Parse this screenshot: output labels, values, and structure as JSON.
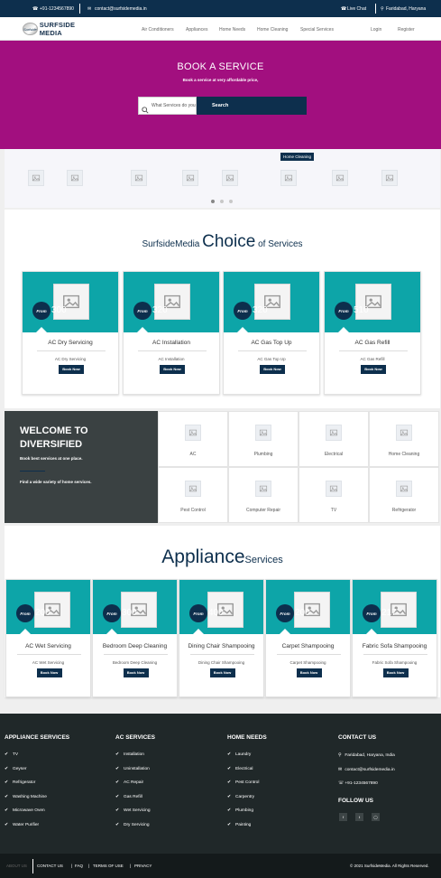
{
  "topbar": {
    "phone": "+91-1234567890",
    "email": "contact@surfsidemedia.in",
    "live_chat": "Live Chat",
    "location": "Faridabad, Haryana"
  },
  "navbar": {
    "logo_mark": "Surfside",
    "brand": "SURFSIDE MEDIA",
    "links": [
      "Air Conditioners",
      "Appliances",
      "Home Needs",
      "Home Cleaning",
      "Special Services"
    ],
    "login": "Login",
    "register": "Register"
  },
  "hero": {
    "title": "BOOK A SERVICE",
    "subtitle": "Book a service at very affordable price,",
    "search_placeholder": "What Services do you want",
    "search_button": "Search"
  },
  "slider": {
    "tag": "Home Cleaning",
    "icon_count_label": "8"
  },
  "choice": {
    "title_prefix": "SurfsideMedia",
    "title_highlight": "Choice",
    "title_suffix": "of Services",
    "from_label": "From",
    "book_label": "Book Now",
    "cards": [
      {
        "price": "300",
        "name": "AC Dry Servicing",
        "sub": "AC Dry Servicing"
      },
      {
        "price": "320",
        "name": "AC Installation",
        "sub": "AC Installation"
      },
      {
        "price": "320",
        "name": "AC Gas Top Up",
        "sub": "AC Gas Top Up"
      },
      {
        "price": "510",
        "name": "AC Gas Refill",
        "sub": "AC Gas Refill"
      }
    ]
  },
  "welcome": {
    "title_line1": "WELCOME TO",
    "title_line2": "DIVERSIFIED",
    "text1": "Book best services at one place.",
    "text2": "Find a wide variety of home services."
  },
  "categories": [
    "AC",
    "Plumbing",
    "Electrical",
    "Home Cleaning",
    "Pest Control",
    "Computer Repair",
    "TV",
    "Refrigerator"
  ],
  "appliance": {
    "title_highlight": "Appliance",
    "title_suffix": "Services",
    "from_label": "From",
    "book_label": "Book Now",
    "cards": [
      {
        "price": "200",
        "name": "AC Wet Servicing",
        "sub": "AC Wet Servicing"
      },
      {
        "price": "300",
        "name": "Bedroom Deep Cleaning",
        "sub": "Bedroom Deep Cleaning"
      },
      {
        "price": "400",
        "name": "Dining Chair Shampooing",
        "sub": "Dining Chair Shampooing"
      },
      {
        "price": "200",
        "name": "Carpet Shampooing",
        "sub": "Carpet Shampooing"
      },
      {
        "price": "217",
        "name": "Fabric Sofa Shampooing",
        "sub": "Fabric Sofa Shampooing"
      }
    ]
  },
  "footer": {
    "col1": {
      "title": "APPLIANCE SERVICES",
      "items": [
        "TV",
        "Geyser",
        "Refrigerator",
        "Washing Machine",
        "Microwave Oven",
        "Water Purifier"
      ]
    },
    "col2": {
      "title": "AC SERVICES",
      "items": [
        "Installation",
        "Uninstallation",
        "AC Repair",
        "Gas Refill",
        "Wet Servicing",
        "Dry Servicing"
      ]
    },
    "col3": {
      "title": "HOME NEEDS",
      "items": [
        "Laundry",
        "Electrical",
        "Pest Control",
        "Carpentry",
        "Plumbing",
        "Painting"
      ]
    },
    "contact": {
      "title": "CONTACT US",
      "address": "Faridabad, Haryana, India",
      "email": "contact@surfsidemedia.in",
      "phone": "+91-1234567890"
    },
    "follow": {
      "title": "FOLLOW US",
      "icons": [
        "facebook-icon",
        "twitter-icon",
        "instagram-icon"
      ]
    }
  },
  "bottom": {
    "links": [
      "ABOUT US",
      "CONTACT US",
      "FAQ",
      "TERMS OF USE",
      "PRIVACY"
    ],
    "copyright": "© 2021 SurfsideMedia. All Rights Reserved."
  },
  "colors": {
    "navy": "#0d2f4d",
    "teal": "#0da5a8",
    "hero": "#a20f7f",
    "footer": "#202829"
  }
}
